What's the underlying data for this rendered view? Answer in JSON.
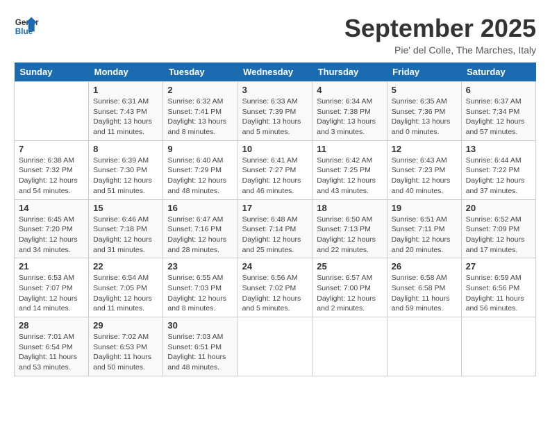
{
  "logo": {
    "line1": "General",
    "line2": "Blue"
  },
  "title": "September 2025",
  "location": "Pie' del Colle, The Marches, Italy",
  "days_of_week": [
    "Sunday",
    "Monday",
    "Tuesday",
    "Wednesday",
    "Thursday",
    "Friday",
    "Saturday"
  ],
  "weeks": [
    [
      {
        "day": "",
        "sunrise": "",
        "sunset": "",
        "daylight": ""
      },
      {
        "day": "1",
        "sunrise": "Sunrise: 6:31 AM",
        "sunset": "Sunset: 7:43 PM",
        "daylight": "Daylight: 13 hours and 11 minutes."
      },
      {
        "day": "2",
        "sunrise": "Sunrise: 6:32 AM",
        "sunset": "Sunset: 7:41 PM",
        "daylight": "Daylight: 13 hours and 8 minutes."
      },
      {
        "day": "3",
        "sunrise": "Sunrise: 6:33 AM",
        "sunset": "Sunset: 7:39 PM",
        "daylight": "Daylight: 13 hours and 5 minutes."
      },
      {
        "day": "4",
        "sunrise": "Sunrise: 6:34 AM",
        "sunset": "Sunset: 7:38 PM",
        "daylight": "Daylight: 13 hours and 3 minutes."
      },
      {
        "day": "5",
        "sunrise": "Sunrise: 6:35 AM",
        "sunset": "Sunset: 7:36 PM",
        "daylight": "Daylight: 13 hours and 0 minutes."
      },
      {
        "day": "6",
        "sunrise": "Sunrise: 6:37 AM",
        "sunset": "Sunset: 7:34 PM",
        "daylight": "Daylight: 12 hours and 57 minutes."
      }
    ],
    [
      {
        "day": "7",
        "sunrise": "Sunrise: 6:38 AM",
        "sunset": "Sunset: 7:32 PM",
        "daylight": "Daylight: 12 hours and 54 minutes."
      },
      {
        "day": "8",
        "sunrise": "Sunrise: 6:39 AM",
        "sunset": "Sunset: 7:30 PM",
        "daylight": "Daylight: 12 hours and 51 minutes."
      },
      {
        "day": "9",
        "sunrise": "Sunrise: 6:40 AM",
        "sunset": "Sunset: 7:29 PM",
        "daylight": "Daylight: 12 hours and 48 minutes."
      },
      {
        "day": "10",
        "sunrise": "Sunrise: 6:41 AM",
        "sunset": "Sunset: 7:27 PM",
        "daylight": "Daylight: 12 hours and 46 minutes."
      },
      {
        "day": "11",
        "sunrise": "Sunrise: 6:42 AM",
        "sunset": "Sunset: 7:25 PM",
        "daylight": "Daylight: 12 hours and 43 minutes."
      },
      {
        "day": "12",
        "sunrise": "Sunrise: 6:43 AM",
        "sunset": "Sunset: 7:23 PM",
        "daylight": "Daylight: 12 hours and 40 minutes."
      },
      {
        "day": "13",
        "sunrise": "Sunrise: 6:44 AM",
        "sunset": "Sunset: 7:22 PM",
        "daylight": "Daylight: 12 hours and 37 minutes."
      }
    ],
    [
      {
        "day": "14",
        "sunrise": "Sunrise: 6:45 AM",
        "sunset": "Sunset: 7:20 PM",
        "daylight": "Daylight: 12 hours and 34 minutes."
      },
      {
        "day": "15",
        "sunrise": "Sunrise: 6:46 AM",
        "sunset": "Sunset: 7:18 PM",
        "daylight": "Daylight: 12 hours and 31 minutes."
      },
      {
        "day": "16",
        "sunrise": "Sunrise: 6:47 AM",
        "sunset": "Sunset: 7:16 PM",
        "daylight": "Daylight: 12 hours and 28 minutes."
      },
      {
        "day": "17",
        "sunrise": "Sunrise: 6:48 AM",
        "sunset": "Sunset: 7:14 PM",
        "daylight": "Daylight: 12 hours and 25 minutes."
      },
      {
        "day": "18",
        "sunrise": "Sunrise: 6:50 AM",
        "sunset": "Sunset: 7:13 PM",
        "daylight": "Daylight: 12 hours and 22 minutes."
      },
      {
        "day": "19",
        "sunrise": "Sunrise: 6:51 AM",
        "sunset": "Sunset: 7:11 PM",
        "daylight": "Daylight: 12 hours and 20 minutes."
      },
      {
        "day": "20",
        "sunrise": "Sunrise: 6:52 AM",
        "sunset": "Sunset: 7:09 PM",
        "daylight": "Daylight: 12 hours and 17 minutes."
      }
    ],
    [
      {
        "day": "21",
        "sunrise": "Sunrise: 6:53 AM",
        "sunset": "Sunset: 7:07 PM",
        "daylight": "Daylight: 12 hours and 14 minutes."
      },
      {
        "day": "22",
        "sunrise": "Sunrise: 6:54 AM",
        "sunset": "Sunset: 7:05 PM",
        "daylight": "Daylight: 12 hours and 11 minutes."
      },
      {
        "day": "23",
        "sunrise": "Sunrise: 6:55 AM",
        "sunset": "Sunset: 7:03 PM",
        "daylight": "Daylight: 12 hours and 8 minutes."
      },
      {
        "day": "24",
        "sunrise": "Sunrise: 6:56 AM",
        "sunset": "Sunset: 7:02 PM",
        "daylight": "Daylight: 12 hours and 5 minutes."
      },
      {
        "day": "25",
        "sunrise": "Sunrise: 6:57 AM",
        "sunset": "Sunset: 7:00 PM",
        "daylight": "Daylight: 12 hours and 2 minutes."
      },
      {
        "day": "26",
        "sunrise": "Sunrise: 6:58 AM",
        "sunset": "Sunset: 6:58 PM",
        "daylight": "Daylight: 11 hours and 59 minutes."
      },
      {
        "day": "27",
        "sunrise": "Sunrise: 6:59 AM",
        "sunset": "Sunset: 6:56 PM",
        "daylight": "Daylight: 11 hours and 56 minutes."
      }
    ],
    [
      {
        "day": "28",
        "sunrise": "Sunrise: 7:01 AM",
        "sunset": "Sunset: 6:54 PM",
        "daylight": "Daylight: 11 hours and 53 minutes."
      },
      {
        "day": "29",
        "sunrise": "Sunrise: 7:02 AM",
        "sunset": "Sunset: 6:53 PM",
        "daylight": "Daylight: 11 hours and 50 minutes."
      },
      {
        "day": "30",
        "sunrise": "Sunrise: 7:03 AM",
        "sunset": "Sunset: 6:51 PM",
        "daylight": "Daylight: 11 hours and 48 minutes."
      },
      {
        "day": "",
        "sunrise": "",
        "sunset": "",
        "daylight": ""
      },
      {
        "day": "",
        "sunrise": "",
        "sunset": "",
        "daylight": ""
      },
      {
        "day": "",
        "sunrise": "",
        "sunset": "",
        "daylight": ""
      },
      {
        "day": "",
        "sunrise": "",
        "sunset": "",
        "daylight": ""
      }
    ]
  ]
}
